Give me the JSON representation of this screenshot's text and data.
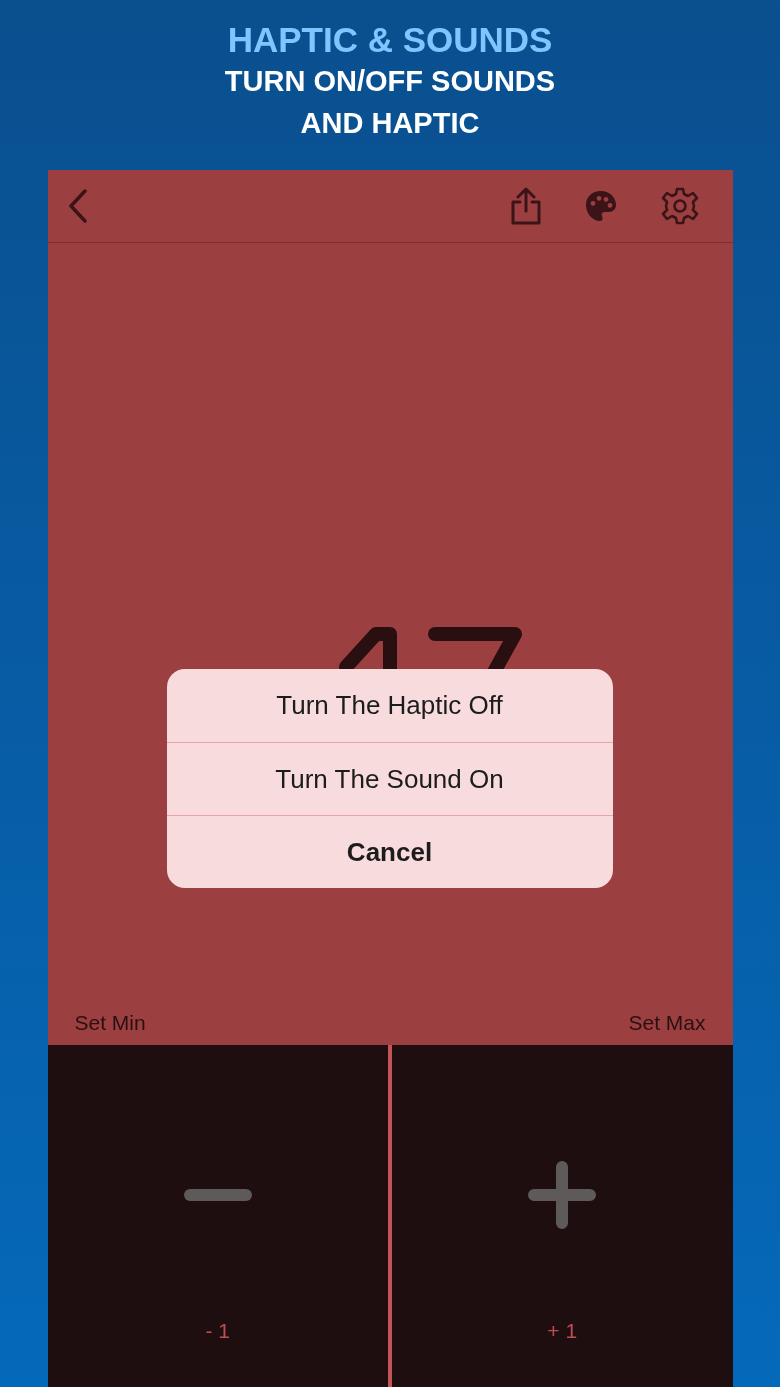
{
  "header": {
    "title": "HAPTIC & SOUNDS",
    "subtitle_lines": [
      "TURN ON/OFF SOUNDS",
      "AND HAPTIC"
    ]
  },
  "limits": {
    "min_label": "Set Min",
    "max_label": "Set Max"
  },
  "steppers": [
    {
      "kind": "decrement",
      "label": "- 1"
    },
    {
      "kind": "increment",
      "label": "+ 1"
    }
  ],
  "action_sheet": {
    "actions": [
      {
        "kind": "option",
        "label": "Turn The Haptic Off"
      },
      {
        "kind": "option",
        "label": "Turn The Sound On"
      },
      {
        "kind": "cancel",
        "label": "Cancel"
      }
    ]
  }
}
